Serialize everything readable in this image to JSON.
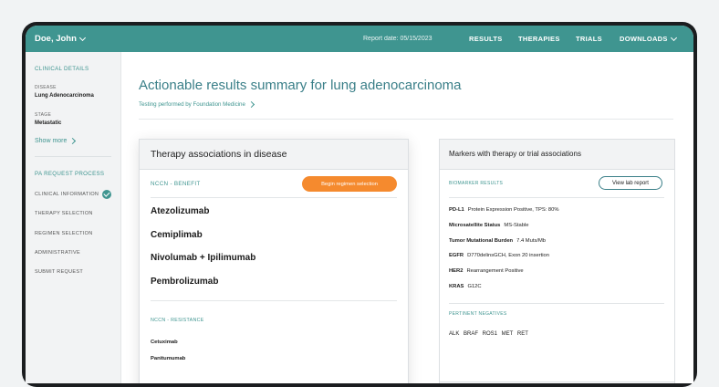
{
  "header": {
    "user": "Doe, John",
    "report_date": "Report date: 05/15/2023",
    "nav": [
      "RESULTS",
      "THERAPIES",
      "TRIALS",
      "DOWNLOADS"
    ],
    "colors": {
      "brand": "#3f9590",
      "accent": "#f58a2e"
    }
  },
  "sidebar": {
    "clinical_heading": "CLINICAL DETAILS",
    "disease_label": "DISEASE",
    "disease_value": "Lung Adenocarcinoma",
    "stage_label": "STAGE",
    "stage_value": "Metastatic",
    "show_more": "Show more",
    "process_heading": "PA REQUEST PROCESS",
    "steps": [
      {
        "label": "CLINICAL INFORMATION",
        "done": true
      },
      {
        "label": "THERAPY SELECTION",
        "done": false
      },
      {
        "label": "REGIMEN SELECTION",
        "done": false
      },
      {
        "label": "ADMINISTRATIVE",
        "done": false
      },
      {
        "label": "SUBMIT REQUEST",
        "done": false
      }
    ]
  },
  "main": {
    "title": "Actionable results summary for lung adenocarcinoma",
    "subtitle": "Testing performed by Foundation Medicine"
  },
  "therapy_card": {
    "title": "Therapy associations in disease",
    "section_benefit": "NCCN - BENEFIT",
    "begin_button": "Begin regimen selection",
    "benefit_drugs": [
      "Atezolizumab",
      "Cemiplimab",
      "Nivolumab + Ipilimumab",
      "Pembrolizumab"
    ],
    "section_resistance": "NCCN - RESISTANCE",
    "resistance_drugs": [
      "Cetuximab",
      "Panitumumab"
    ]
  },
  "markers_card": {
    "title": "Markers with therapy or trial associations",
    "section_results": "BIOMARKER RESULTS",
    "view_lab_button": "View lab report",
    "markers": [
      {
        "name": "PD-L1",
        "detail": "Protein Expression Positive, TPS: 80%"
      },
      {
        "name": "Microsatellite Status",
        "detail": "MS-Stable"
      },
      {
        "name": "Tumor Mutational Burden",
        "detail": "7.4 Muts/Mb"
      },
      {
        "name": "EGFR",
        "detail": "D770delinsGCH, Exon 20 insertion"
      },
      {
        "name": "HER2",
        "detail": "Rearrangement Positive"
      },
      {
        "name": "KRAS",
        "detail": "G12C"
      }
    ],
    "section_negatives": "PERTINENT NEGATIVES",
    "negatives": "ALK  BRAF  ROS1  MET  RET"
  }
}
